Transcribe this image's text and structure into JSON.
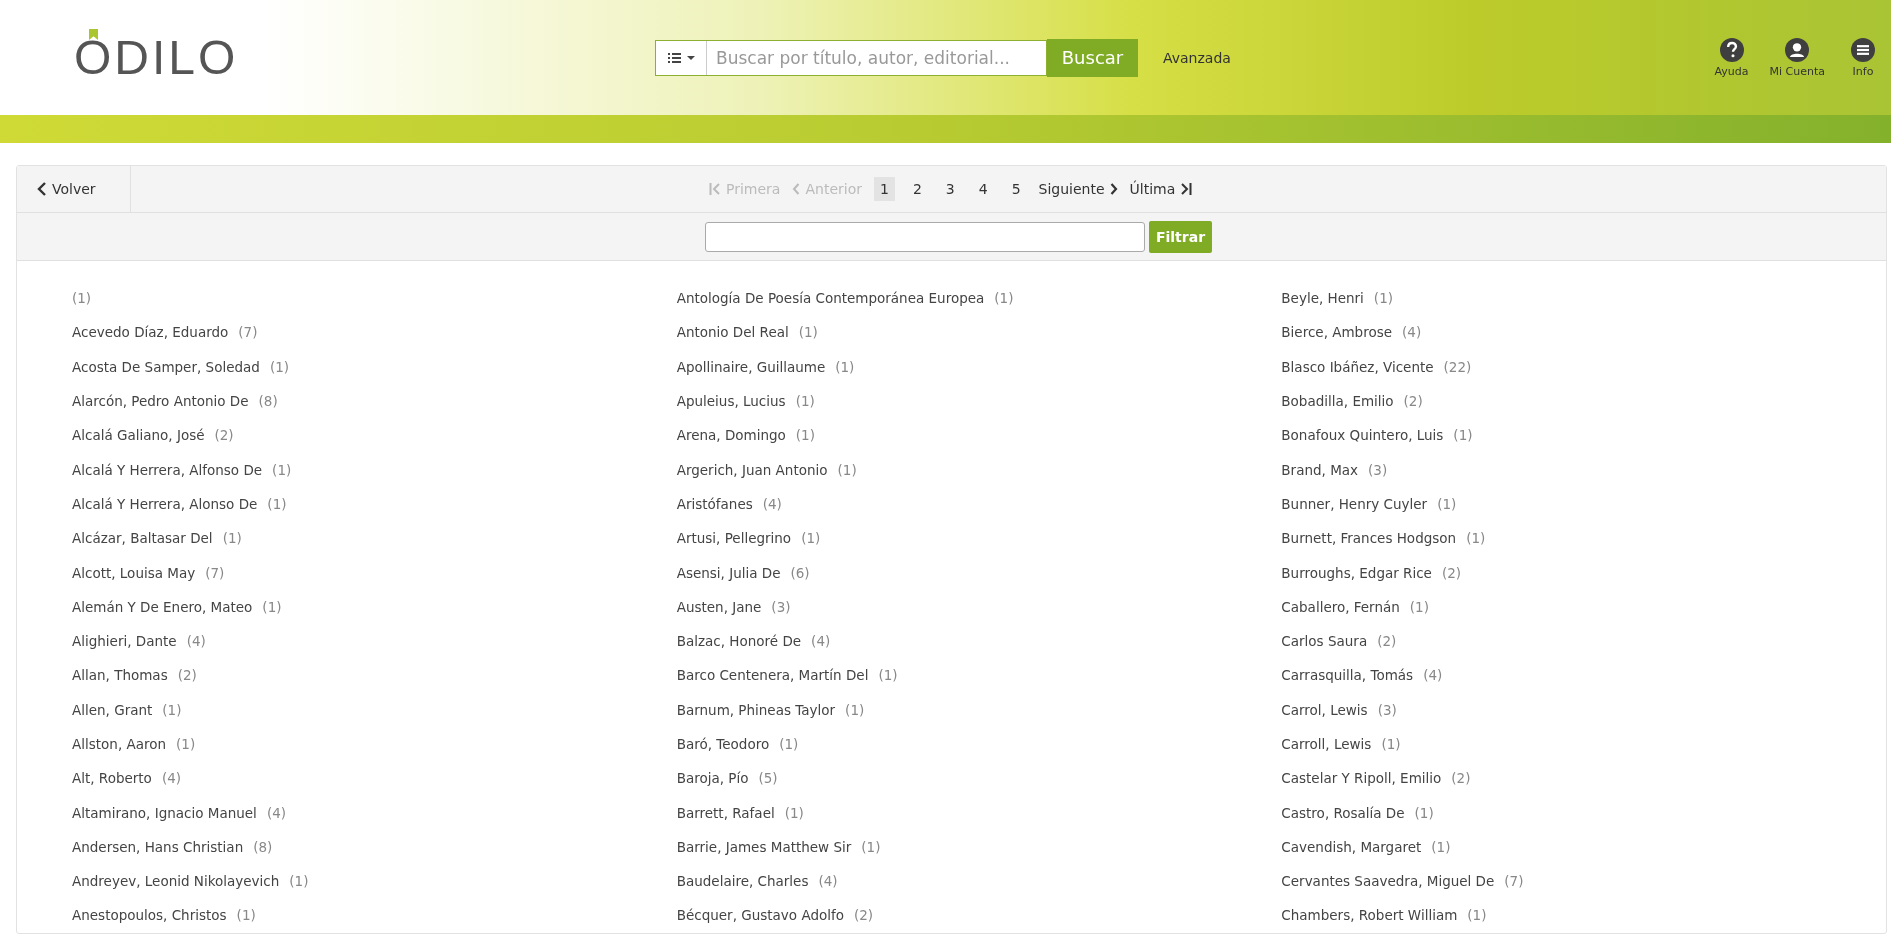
{
  "header": {
    "logo": "ODILO",
    "search": {
      "placeholder": "Buscar por título, autor, editorial...",
      "button": "Buscar"
    },
    "advanced_link": "Avanzada",
    "actions": [
      {
        "kind": "help",
        "label": "Ayuda"
      },
      {
        "kind": "account",
        "label": "Mi Cuenta"
      },
      {
        "kind": "menu",
        "label": "Info"
      }
    ]
  },
  "toolbar": {
    "back": "Volver",
    "first": {
      "label": "Primera",
      "disabled": true
    },
    "previous": {
      "label": "Anterior",
      "disabled": true
    },
    "pages": [
      {
        "label": "1",
        "selected": true
      },
      {
        "label": "2",
        "selected": false
      },
      {
        "label": "3",
        "selected": false
      },
      {
        "label": "4",
        "selected": false
      },
      {
        "label": "5",
        "selected": false
      }
    ],
    "next": {
      "label": "Siguiente",
      "disabled": false
    },
    "last": {
      "label": "Última",
      "disabled": false
    }
  },
  "filter": {
    "button": "Filtrar"
  },
  "columns": [
    [
      {
        "count": "(1)"
      },
      {
        "name": "Acevedo Díaz, Eduardo",
        "count": "(7)"
      },
      {
        "name": "Acosta De Samper, Soledad",
        "count": "(1)"
      },
      {
        "name": "Alarcón, Pedro Antonio De",
        "count": "(8)"
      },
      {
        "name": "Alcalá Galiano, José",
        "count": "(2)"
      },
      {
        "name": "Alcalá Y Herrera, Alfonso De",
        "count": "(1)"
      },
      {
        "name": "Alcalá Y Herrera, Alonso De",
        "count": "(1)"
      },
      {
        "name": "Alcázar, Baltasar Del",
        "count": "(1)"
      },
      {
        "name": "Alcott, Louisa May",
        "count": "(7)"
      },
      {
        "name": "Alemán Y De Enero, Mateo",
        "count": "(1)"
      },
      {
        "name": "Alighieri, Dante",
        "count": "(4)"
      },
      {
        "name": "Allan, Thomas",
        "count": "(2)"
      },
      {
        "name": "Allen, Grant",
        "count": "(1)"
      },
      {
        "name": "Allston, Aaron",
        "count": "(1)"
      },
      {
        "name": "Alt, Roberto",
        "count": "(4)"
      },
      {
        "name": "Altamirano, Ignacio Manuel",
        "count": "(4)"
      },
      {
        "name": "Andersen, Hans Christian",
        "count": "(8)"
      },
      {
        "name": "Andreyev, Leonid Nikolayevich",
        "count": "(1)"
      },
      {
        "name": "Anestopoulos, Christos",
        "count": "(1)"
      }
    ],
    [
      {
        "name": "Antología De Poesía Contemporánea Europea",
        "count": "(1)"
      },
      {
        "name": "Antonio Del Real",
        "count": "(1)"
      },
      {
        "name": "Apollinaire, Guillaume",
        "count": "(1)"
      },
      {
        "name": "Apuleius, Lucius",
        "count": "(1)"
      },
      {
        "name": "Arena, Domingo",
        "count": "(1)"
      },
      {
        "name": "Argerich, Juan Antonio",
        "count": "(1)"
      },
      {
        "name": "Aristófanes",
        "count": "(4)"
      },
      {
        "name": "Artusi, Pellegrino",
        "count": "(1)"
      },
      {
        "name": "Asensi, Julia De",
        "count": "(6)"
      },
      {
        "name": "Austen, Jane",
        "count": "(3)"
      },
      {
        "name": "Balzac, Honoré De",
        "count": "(4)"
      },
      {
        "name": "Barco Centenera, Martín Del",
        "count": "(1)"
      },
      {
        "name": "Barnum, Phineas Taylor",
        "count": "(1)"
      },
      {
        "name": "Baró, Teodoro",
        "count": "(1)"
      },
      {
        "name": "Baroja, Pío",
        "count": "(5)"
      },
      {
        "name": "Barrett, Rafael",
        "count": "(1)"
      },
      {
        "name": "Barrie, James Matthew Sir",
        "count": "(1)"
      },
      {
        "name": "Baudelaire, Charles",
        "count": "(4)"
      },
      {
        "name": "Bécquer, Gustavo Adolfo",
        "count": "(2)"
      }
    ],
    [
      {
        "name": "Beyle, Henri",
        "count": "(1)"
      },
      {
        "name": "Bierce, Ambrose",
        "count": "(4)"
      },
      {
        "name": "Blasco Ibáñez, Vicente",
        "count": "(22)"
      },
      {
        "name": "Bobadilla, Emilio",
        "count": "(2)"
      },
      {
        "name": "Bonafoux Quintero, Luis",
        "count": "(1)"
      },
      {
        "name": "Brand, Max",
        "count": "(3)"
      },
      {
        "name": "Bunner, Henry Cuyler",
        "count": "(1)"
      },
      {
        "name": "Burnett, Frances Hodgson",
        "count": "(1)"
      },
      {
        "name": "Burroughs, Edgar Rice",
        "count": "(2)"
      },
      {
        "name": "Caballero, Fernán",
        "count": "(1)"
      },
      {
        "name": "Carlos Saura",
        "count": "(2)"
      },
      {
        "name": "Carrasquilla, Tomás",
        "count": "(4)"
      },
      {
        "name": "Carrol, Lewis",
        "count": "(3)"
      },
      {
        "name": "Carroll, Lewis",
        "count": "(1)"
      },
      {
        "name": "Castelar Y Ripoll, Emilio",
        "count": "(2)"
      },
      {
        "name": "Castro, Rosalía De",
        "count": "(1)"
      },
      {
        "name": "Cavendish, Margaret",
        "count": "(1)"
      },
      {
        "name": "Cervantes Saavedra, Miguel De",
        "count": "(7)"
      },
      {
        "name": "Chambers, Robert William",
        "count": "(1)"
      }
    ]
  ]
}
